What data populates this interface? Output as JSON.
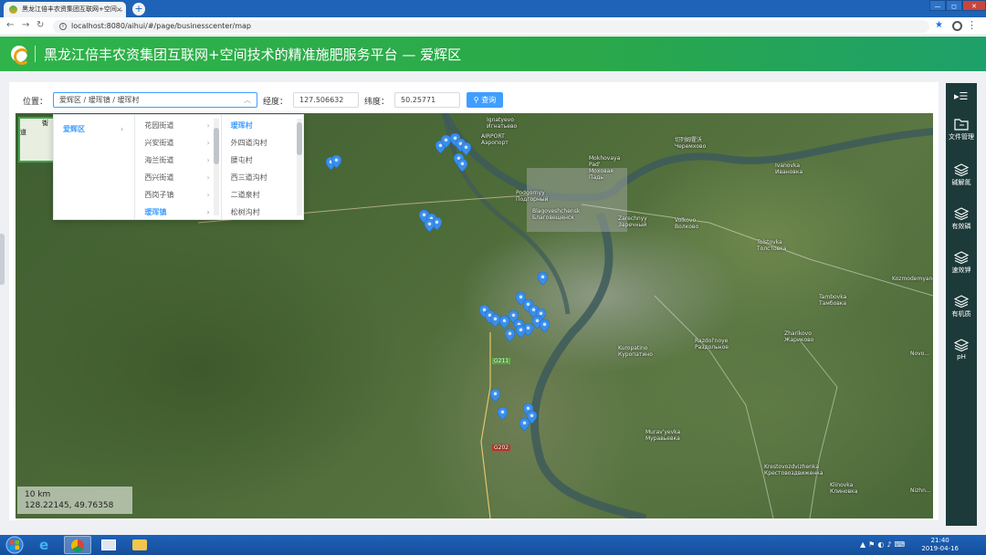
{
  "browser": {
    "tab_title": "黑龙江倍丰农资集团互联网+空间...",
    "tab_close": "×",
    "new_tab": "+",
    "url": "localhost:8080/aihui/#/page/businesscenter/map",
    "win_min": "—",
    "win_max": "◻",
    "win_close": "✕"
  },
  "app": {
    "title": "黑龙江倍丰农资集团互联网+空间技术的精准施肥服务平台 — 爱辉区"
  },
  "toolbar": {
    "location_label": "位置：",
    "location_value": "爱辉区 / 瑷珲镇 / 瑷珲村",
    "lon_label": "经度：",
    "lon_value": "127.506632",
    "lat_label": "纬度：",
    "lat_value": "50.25771",
    "query_label": "查询"
  },
  "cascader": {
    "level1": [
      {
        "label": "爱辉区",
        "active": true
      }
    ],
    "level2": [
      {
        "label": "花园街道"
      },
      {
        "label": "兴安街道"
      },
      {
        "label": "海兰街道"
      },
      {
        "label": "西兴街道"
      },
      {
        "label": "西岗子镇"
      },
      {
        "label": "瑷珲镇",
        "active": true
      }
    ],
    "level3": [
      {
        "label": "瑷珲村",
        "active": true
      },
      {
        "label": "外四道沟村"
      },
      {
        "label": "腰屯村"
      },
      {
        "label": "西三道沟村"
      },
      {
        "label": "二道泉村"
      },
      {
        "label": "松树沟村"
      }
    ]
  },
  "map": {
    "minimap_label": "街道",
    "scale": "10 km",
    "coords": "128.22145, 49.76358",
    "labels": [
      {
        "text": "Ignatyevo\nИгнатьево"
      },
      {
        "text": "AIRPORT\nАэропорт"
      },
      {
        "text": "Mokhovaya\nPad'\nМоховая\nПадь"
      },
      {
        "text": "切列姆霍沃\nЧеремхово"
      },
      {
        "text": "Podgornyy\nПодгорный"
      },
      {
        "text": "Blagoveshchensk\nБлаговещенск"
      },
      {
        "text": "Zarechnyy\nЗаречный"
      },
      {
        "text": "Volkovo\nВолково"
      },
      {
        "text": "Tolstovka\nТолстовка"
      },
      {
        "text": "Kozmodemyanovka"
      },
      {
        "text": "Tambovka\nТамбовка"
      },
      {
        "text": "Zharikovo\nЖариково"
      },
      {
        "text": "Kuropatino\nКуропатино"
      },
      {
        "text": "Razdol'noye\nРаздольное"
      },
      {
        "text": "Novo..."
      },
      {
        "text": "Murav'yevka\nМуравьевка"
      },
      {
        "text": "Krestovozdvizhenka\nКрестовоздвиженка"
      },
      {
        "text": "Klinovka\nКлиновка"
      },
      {
        "text": "Ivanovka\nИвановка"
      },
      {
        "text": "Nizhn..."
      },
      {
        "text": "G211"
      },
      {
        "text": "G202"
      }
    ]
  },
  "sidebar": {
    "tools": [
      {
        "label": "文件管理",
        "icon": "folder-icon"
      },
      {
        "label": "碱解氮",
        "icon": "layers-icon"
      },
      {
        "label": "有效磷",
        "icon": "layers-icon"
      },
      {
        "label": "速效钾",
        "icon": "layers-icon"
      },
      {
        "label": "有机质",
        "icon": "layers-icon"
      },
      {
        "label": "pH",
        "icon": "layers-icon"
      }
    ]
  },
  "taskbar": {
    "time": "21:40",
    "date": "2019-04-16"
  },
  "colors": {
    "header_green": "#2fb34a",
    "primary_blue": "#409eff",
    "sidebar_bg": "#1d3a3a",
    "pin_blue": "#3b8ee8"
  }
}
